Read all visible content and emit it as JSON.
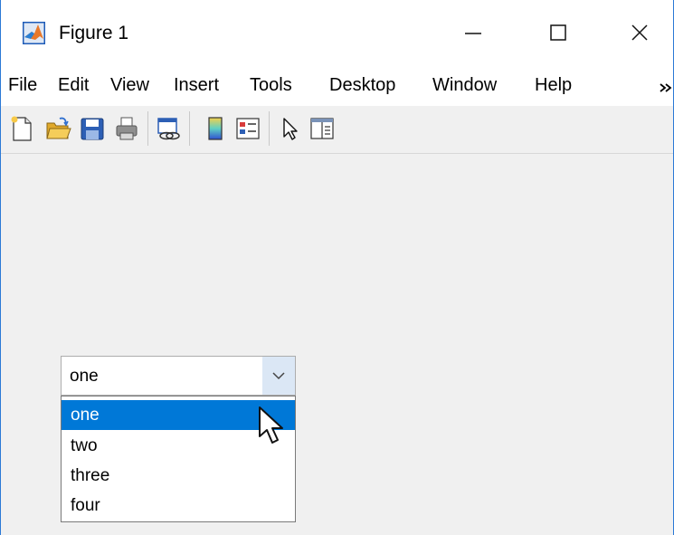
{
  "window": {
    "title": "Figure 1",
    "icon": "matlab-logo-icon",
    "controls": [
      "minimize-icon",
      "maximize-icon",
      "close-icon"
    ],
    "border_color": "#2b79d6"
  },
  "menubar": {
    "items": [
      "File",
      "Edit",
      "View",
      "Insert",
      "Tools",
      "Desktop",
      "Window",
      "Help"
    ],
    "overflow_icon": "chevron-more-icon"
  },
  "toolbar": {
    "buttons": [
      "new-figure-icon",
      "open-file-icon",
      "save-figure-icon",
      "print-figure-icon",
      "link-plot-icon",
      "insert-colorbar-icon",
      "insert-legend-icon",
      "edit-plot-icon",
      "property-inspector-icon"
    ]
  },
  "popup_menu": {
    "value": "one",
    "expanded": true,
    "options": [
      "one",
      "two",
      "three",
      "four"
    ],
    "highlighted_index": 0,
    "highlight_color": "#0078d7"
  }
}
